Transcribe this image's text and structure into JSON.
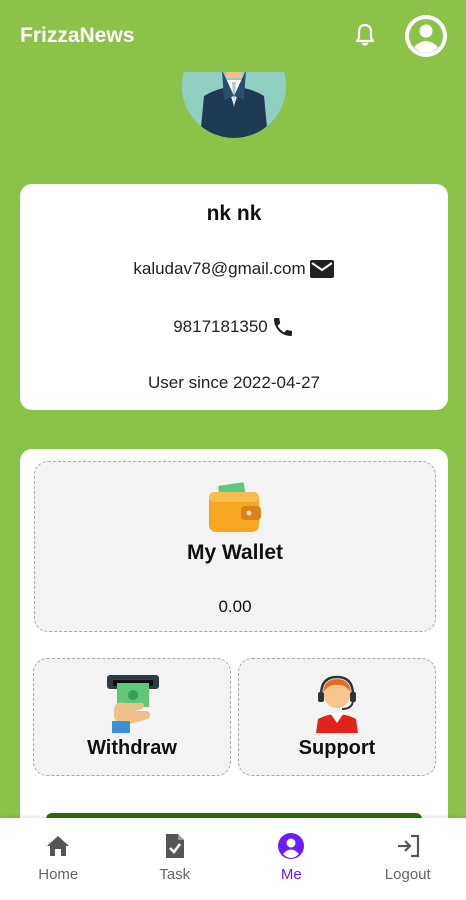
{
  "app": {
    "title": "FrizzaNews"
  },
  "profile": {
    "name": "nk nk",
    "email": "kaludav78@gmail.com",
    "phone": "9817181350",
    "user_since": "User since 2022-04-27"
  },
  "wallet": {
    "label": "My Wallet",
    "amount": "0.00"
  },
  "actions": [
    {
      "label": "Withdraw",
      "icon": "cash-withdraw-icon"
    },
    {
      "label": "Support",
      "icon": "support-agent-icon"
    }
  ],
  "nav": [
    {
      "label": "Home",
      "icon": "home-icon",
      "active": false
    },
    {
      "label": "Task",
      "icon": "task-icon",
      "active": false
    },
    {
      "label": "Me",
      "icon": "account-circle-icon",
      "active": true
    },
    {
      "label": "Logout",
      "icon": "logout-icon",
      "active": false
    }
  ],
  "colors": {
    "background": "#8bc34a",
    "accent": "#6a1bff",
    "card": "#ffffff",
    "tile": "#f3f3f3"
  }
}
